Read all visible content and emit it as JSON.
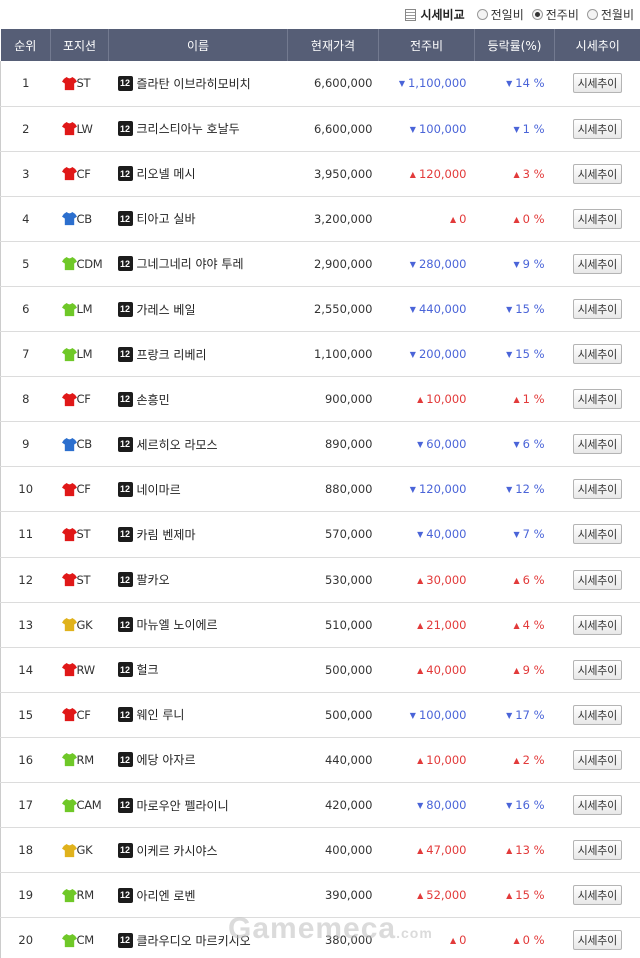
{
  "compare": {
    "title": "시세비교",
    "options": [
      {
        "label": "전일비",
        "selected": false
      },
      {
        "label": "전주비",
        "selected": true
      },
      {
        "label": "전월비",
        "selected": false
      }
    ]
  },
  "columns": [
    "순위",
    "포지션",
    "이름",
    "현재가격",
    "전주비",
    "등락률(%)",
    "시세추이"
  ],
  "badge": "12",
  "button_label": "시세추이",
  "colors": {
    "header_bg": "#565e76",
    "up": "#e23a3a",
    "down": "#4a64d8"
  },
  "position_colors": {
    "red": "#e01818",
    "blue": "#2c6fce",
    "green": "#6fc828",
    "yellow": "#e0b21c"
  },
  "rows": [
    {
      "rank": "1",
      "pos": "ST",
      "shirt": "red",
      "name": "즐라탄 이브라히모비치",
      "price": "6,600,000",
      "dir": "down",
      "change": "1,100,000",
      "rate": "14 %"
    },
    {
      "rank": "2",
      "pos": "LW",
      "shirt": "red",
      "name": "크리스티아누 호날두",
      "price": "6,600,000",
      "dir": "down",
      "change": "100,000",
      "rate": "1 %"
    },
    {
      "rank": "3",
      "pos": "CF",
      "shirt": "red",
      "name": "리오넬 메시",
      "price": "3,950,000",
      "dir": "up",
      "change": "120,000",
      "rate": "3 %"
    },
    {
      "rank": "4",
      "pos": "CB",
      "shirt": "blue",
      "name": "티아고 실바",
      "price": "3,200,000",
      "dir": "up",
      "change": "0",
      "rate": "0 %"
    },
    {
      "rank": "5",
      "pos": "CDM",
      "shirt": "green",
      "name": "그네그네리 야야 투레",
      "price": "2,900,000",
      "dir": "down",
      "change": "280,000",
      "rate": "9 %"
    },
    {
      "rank": "6",
      "pos": "LM",
      "shirt": "green",
      "name": "가레스 베일",
      "price": "2,550,000",
      "dir": "down",
      "change": "440,000",
      "rate": "15 %"
    },
    {
      "rank": "7",
      "pos": "LM",
      "shirt": "green",
      "name": "프랑크 리베리",
      "price": "1,100,000",
      "dir": "down",
      "change": "200,000",
      "rate": "15 %"
    },
    {
      "rank": "8",
      "pos": "CF",
      "shirt": "red",
      "name": "손흥민",
      "price": "900,000",
      "dir": "up",
      "change": "10,000",
      "rate": "1 %"
    },
    {
      "rank": "9",
      "pos": "CB",
      "shirt": "blue",
      "name": "세르히오 라모스",
      "price": "890,000",
      "dir": "down",
      "change": "60,000",
      "rate": "6 %"
    },
    {
      "rank": "10",
      "pos": "CF",
      "shirt": "red",
      "name": "네이마르",
      "price": "880,000",
      "dir": "down",
      "change": "120,000",
      "rate": "12 %"
    },
    {
      "rank": "11",
      "pos": "ST",
      "shirt": "red",
      "name": "카림 벤제마",
      "price": "570,000",
      "dir": "down",
      "change": "40,000",
      "rate": "7 %"
    },
    {
      "rank": "12",
      "pos": "ST",
      "shirt": "red",
      "name": "팔카오",
      "price": "530,000",
      "dir": "up",
      "change": "30,000",
      "rate": "6 %"
    },
    {
      "rank": "13",
      "pos": "GK",
      "shirt": "yellow",
      "name": "마뉴엘 노이에르",
      "price": "510,000",
      "dir": "up",
      "change": "21,000",
      "rate": "4 %"
    },
    {
      "rank": "14",
      "pos": "RW",
      "shirt": "red",
      "name": "헐크",
      "price": "500,000",
      "dir": "up",
      "change": "40,000",
      "rate": "9 %"
    },
    {
      "rank": "15",
      "pos": "CF",
      "shirt": "red",
      "name": "웨인 루니",
      "price": "500,000",
      "dir": "down",
      "change": "100,000",
      "rate": "17 %"
    },
    {
      "rank": "16",
      "pos": "RM",
      "shirt": "green",
      "name": "에당 아자르",
      "price": "440,000",
      "dir": "up",
      "change": "10,000",
      "rate": "2 %"
    },
    {
      "rank": "17",
      "pos": "CAM",
      "shirt": "green",
      "name": "마로우안 펠라이니",
      "price": "420,000",
      "dir": "down",
      "change": "80,000",
      "rate": "16 %"
    },
    {
      "rank": "18",
      "pos": "GK",
      "shirt": "yellow",
      "name": "이케르 카시야스",
      "price": "400,000",
      "dir": "up",
      "change": "47,000",
      "rate": "13 %"
    },
    {
      "rank": "19",
      "pos": "RM",
      "shirt": "green",
      "name": "아리엔 로벤",
      "price": "390,000",
      "dir": "up",
      "change": "52,000",
      "rate": "15 %"
    },
    {
      "rank": "20",
      "pos": "CM",
      "shirt": "green",
      "name": "클라우디오 마르키시오",
      "price": "380,000",
      "dir": "up",
      "change": "0",
      "rate": "0 %"
    }
  ],
  "watermark": "Gamemeca"
}
